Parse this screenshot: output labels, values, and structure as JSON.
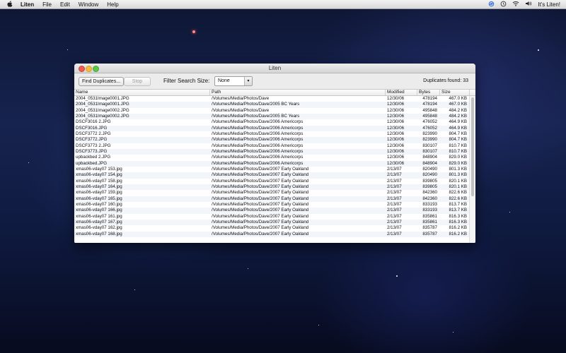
{
  "menubar": {
    "apple_glyph": "",
    "app_name": "Liten",
    "items": [
      "File",
      "Edit",
      "Window",
      "Help"
    ],
    "status_text": "It's Liten!"
  },
  "window": {
    "title": "Liten",
    "find_button": "Find Duplicates...",
    "stop_button": "Stop",
    "filter_label": "Filter Search Size:",
    "filter_value": "None",
    "duplicates_found": "Duplicates found: 33"
  },
  "table": {
    "columns": [
      "Name",
      "Path",
      "Modified",
      "Bytes",
      "Size"
    ],
    "rows": [
      [
        "2004_0531Image0001.JPG",
        "/Volumes/Media/Photos/Dave",
        "12/30/06",
        "478194",
        "467.0 KB"
      ],
      [
        "2004_0531Image0001.JPG",
        "/Volumes/Media/Photos/Dave/2005 BC Years",
        "12/30/06",
        "478194",
        "467.0 KB"
      ],
      [
        "2004_0531Image0002.JPG",
        "/Volumes/Media/Photos/Dave",
        "12/30/06",
        "495848",
        "484.2 KB"
      ],
      [
        "2004_0531Image0002.JPG",
        "/Volumes/Media/Photos/Dave/2005 BC Years",
        "12/30/06",
        "495848",
        "484.2 KB"
      ],
      [
        "DSCF3016 2.JPG",
        "/Volumes/Media/Photos/Dave/2006 Americorps",
        "12/30/06",
        "476052",
        "464.9 KB"
      ],
      [
        "DSCF3016.JPG",
        "/Volumes/Media/Photos/Dave/2006 Americorps",
        "12/30/06",
        "476052",
        "464.9 KB"
      ],
      [
        "DSCF3772 2.JPG",
        "/Volumes/Media/Photos/Dave/2006 Americorps",
        "12/30/06",
        "823990",
        "804.7 KB"
      ],
      [
        "DSCF3772.JPG",
        "/Volumes/Media/Photos/Dave/2006 Americorps",
        "12/30/06",
        "823990",
        "804.7 KB"
      ],
      [
        "DSCF3773 2.JPG",
        "/Volumes/Media/Photos/Dave/2006 Americorps",
        "12/30/06",
        "830107",
        "810.7 KB"
      ],
      [
        "DSCF3773.JPG",
        "/Volumes/Media/Photos/Dave/2006 Americorps",
        "12/30/06",
        "830107",
        "810.7 KB"
      ],
      [
        "upbackbed 2.JPG",
        "/Volumes/Media/Photos/Dave/2006 Americorps",
        "12/30/06",
        "848904",
        "829.0 KB"
      ],
      [
        "upbackbed.JPG",
        "/Volumes/Media/Photos/Dave/2006 Americorps",
        "12/30/06",
        "848904",
        "829.0 KB"
      ],
      [
        "xmas06-vday07 153.jpg",
        "/Volumes/Media/Photos/Dave/2007 Early Oakland",
        "2/13/07",
        "820490",
        "801.3 KB"
      ],
      [
        "xmas06-vday07 154.jpg",
        "/Volumes/Media/Photos/Dave/2007 Early Oakland",
        "2/13/07",
        "820490",
        "801.3 KB"
      ],
      [
        "xmas06-vday07 158.jpg",
        "/Volumes/Media/Photos/Dave/2007 Early Oakland",
        "2/13/07",
        "839805",
        "820.1 KB"
      ],
      [
        "xmas06-vday07 164.jpg",
        "/Volumes/Media/Photos/Dave/2007 Early Oakland",
        "2/13/07",
        "839805",
        "820.1 KB"
      ],
      [
        "xmas06-vday07 159.jpg",
        "/Volumes/Media/Photos/Dave/2007 Early Oakland",
        "2/13/07",
        "842360",
        "822.6 KB"
      ],
      [
        "xmas06-vday07 165.jpg",
        "/Volumes/Media/Photos/Dave/2007 Early Oakland",
        "2/13/07",
        "842360",
        "822.6 KB"
      ],
      [
        "xmas06-vday07 160.jpg",
        "/Volumes/Media/Photos/Dave/2007 Early Oakland",
        "2/13/07",
        "833193",
        "813.7 KB"
      ],
      [
        "xmas06-vday07 166.jpg",
        "/Volumes/Media/Photos/Dave/2007 Early Oakland",
        "2/13/07",
        "833193",
        "813.7 KB"
      ],
      [
        "xmas06-vday07 161.jpg",
        "/Volumes/Media/Photos/Dave/2007 Early Oakland",
        "2/13/07",
        "835861",
        "816.3 KB"
      ],
      [
        "xmas06-vday07 167.jpg",
        "/Volumes/Media/Photos/Dave/2007 Early Oakland",
        "2/13/07",
        "835861",
        "816.3 KB"
      ],
      [
        "xmas06-vday07 162.jpg",
        "/Volumes/Media/Photos/Dave/2007 Early Oakland",
        "2/13/07",
        "835787",
        "816.2 KB"
      ],
      [
        "xmas06-vday07 168.jpg",
        "/Volumes/Media/Photos/Dave/2007 Early Oakland",
        "2/13/07",
        "835787",
        "816.2 KB"
      ]
    ]
  },
  "icons": [
    "apple-icon",
    "sync-icon",
    "time-machine-icon",
    "wifi-icon",
    "volume-icon"
  ],
  "colors": {
    "close": "#ef5c53",
    "minimize": "#f6bd3c",
    "maximize": "#5fc748",
    "alt_row": "#f2f5fa"
  }
}
